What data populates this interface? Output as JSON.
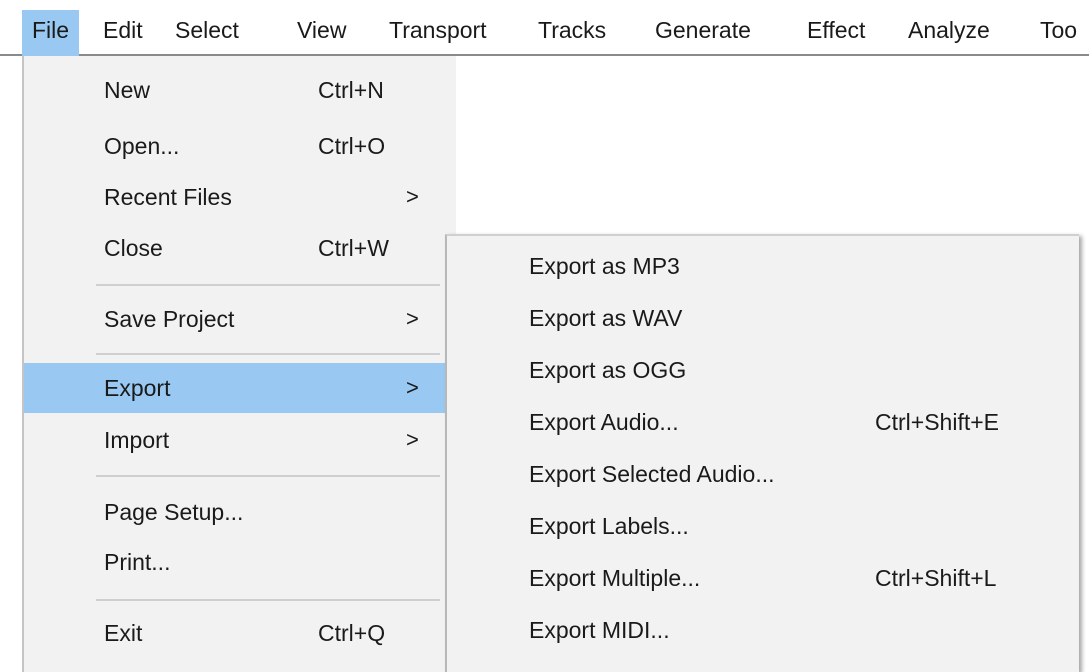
{
  "menubar": {
    "items": [
      "File",
      "Edit",
      "Select",
      "View",
      "Transport",
      "Tracks",
      "Generate",
      "Effect",
      "Analyze",
      "Too"
    ]
  },
  "file_menu": {
    "items": [
      {
        "label": "New",
        "shortcut": "Ctrl+N"
      },
      {
        "label": "Open...",
        "shortcut": "Ctrl+O"
      },
      {
        "label": "Recent Files",
        "submenu_arrow": ">"
      },
      {
        "label": "Close",
        "shortcut": "Ctrl+W"
      },
      {
        "label": "Save Project",
        "submenu_arrow": ">"
      },
      {
        "label": "Export",
        "submenu_arrow": ">"
      },
      {
        "label": "Import",
        "submenu_arrow": ">"
      },
      {
        "label": "Page Setup..."
      },
      {
        "label": "Print..."
      },
      {
        "label": "Exit",
        "shortcut": "Ctrl+Q"
      }
    ]
  },
  "export_menu": {
    "items": [
      {
        "label": "Export as MP3"
      },
      {
        "label": "Export as WAV"
      },
      {
        "label": "Export as OGG"
      },
      {
        "label": "Export Audio...",
        "shortcut": "Ctrl+Shift+E"
      },
      {
        "label": "Export Selected Audio..."
      },
      {
        "label": "Export Labels..."
      },
      {
        "label": "Export Multiple...",
        "shortcut": "Ctrl+Shift+L"
      },
      {
        "label": "Export MIDI..."
      }
    ]
  },
  "colors": {
    "highlight": "#99c9f2",
    "menu_background": "#f2f2f2",
    "separator": "#cfcfcf"
  }
}
